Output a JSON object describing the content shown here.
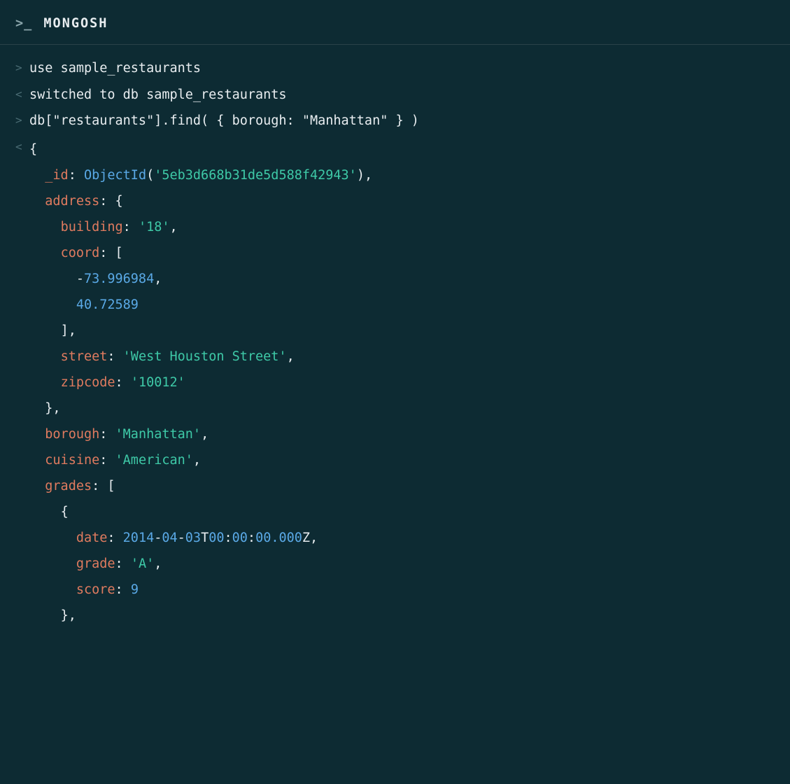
{
  "header": {
    "prompt_glyph": ">_",
    "title": "MONGOSH"
  },
  "gutters": {
    "input": ">",
    "output": "<"
  },
  "lines": {
    "cmd1": "use sample_restaurants",
    "out1": "switched to db sample_restaurants",
    "cmd2": "db[\"restaurants\"].find( { borough: \"Manhattan\" } )"
  },
  "result": {
    "open_brace": "{",
    "id_key": "_id",
    "id_func": "ObjectId",
    "id_lparen": "(",
    "id_val": "'5eb3d668b31de5d588f42943'",
    "id_rparen_comma": "),",
    "address_key": "address",
    "address_open": ": {",
    "building_key": "building",
    "building_val": "'18'",
    "coord_key": "coord",
    "coord_open": ": [",
    "coord_neg": "-",
    "coord0": "73.996984",
    "coord1": "40.72589",
    "array_close": "],",
    "street_key": "street",
    "street_val": "'West Houston Street'",
    "zipcode_key": "zipcode",
    "zipcode_val": "'10012'",
    "obj_close": "},",
    "borough_key": "borough",
    "borough_val": "'Manhattan'",
    "cuisine_key": "cuisine",
    "cuisine_val": "'American'",
    "grades_key": "grades",
    "grades_open": ": [",
    "inner_open": "{",
    "date_key": "date",
    "date_y": "2014",
    "date_sep1": "-",
    "date_m": "04",
    "date_sep2": "-",
    "date_d": "03",
    "date_T": "T",
    "date_hh": "00",
    "date_colon": ":",
    "date_mm": "00",
    "date_ss": "00.000",
    "date_Z": "Z",
    "grade_key": "grade",
    "grade_val": "'A'",
    "score_key": "score",
    "score_val": "9",
    "colon_sp": ": ",
    "comma": ",",
    "comma_trail": ","
  },
  "indent": {
    "i1": "  ",
    "i2": "    ",
    "i3": "      ",
    "i4": "        "
  }
}
